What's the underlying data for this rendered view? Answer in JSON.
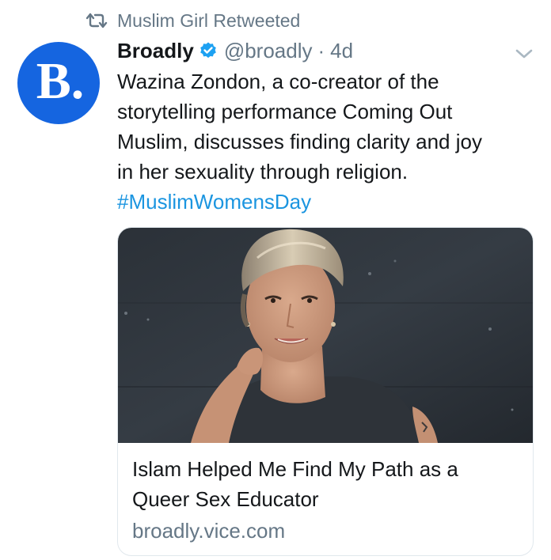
{
  "retweet": {
    "icon": "retweet-icon",
    "label": "Muslim Girl Retweeted"
  },
  "author": {
    "avatar_letter": "B.",
    "avatar_color": "#1565e0",
    "name": "Broadly",
    "verified_icon": "verified-badge-icon",
    "handle": "@broadly",
    "separator": "·",
    "time": "4d"
  },
  "tweet": {
    "text_lines": [
      "Wazina Zondon, a co-creator of the",
      "storytelling performance Coming Out",
      "Muslim, discusses finding clarity and joy",
      "in her sexuality through religion."
    ],
    "hashtag": "#MuslimWomensDay",
    "hashtag_color": "#1b95e0"
  },
  "card": {
    "image_icon": "article-photo",
    "title_lines": [
      "Islam Helped Me Find My Path as a",
      "Queer Sex Educator"
    ],
    "domain": "broadly.vice.com"
  },
  "menu_icon": "chevron-down-icon"
}
